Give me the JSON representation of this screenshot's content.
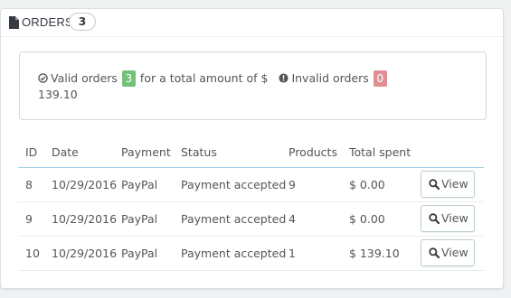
{
  "panel": {
    "title": "ORDERS",
    "count": "3",
    "icon": "file-icon"
  },
  "summary": {
    "valid_prefix": "Valid orders",
    "valid_count": "3",
    "valid_suffix": "for a total amount of $",
    "total_amount": "139.10",
    "invalid_label": "Invalid orders",
    "invalid_count": "0",
    "colors": {
      "valid_badge": "#72c279",
      "invalid_badge": "#e08f95"
    }
  },
  "table": {
    "columns": [
      "ID",
      "Date",
      "Payment",
      "Status",
      "Products",
      "Total spent"
    ],
    "rows": [
      {
        "id": "8",
        "date": "10/29/2016",
        "payment": "PayPal",
        "status": "Payment accepted",
        "products": "9",
        "total": "$ 0.00",
        "action": "View"
      },
      {
        "id": "9",
        "date": "10/29/2016",
        "payment": "PayPal",
        "status": "Payment accepted",
        "products": "4",
        "total": "$ 0.00",
        "action": "View"
      },
      {
        "id": "10",
        "date": "10/29/2016",
        "payment": "PayPal",
        "status": "Payment accepted",
        "products": "1",
        "total": "$ 139.10",
        "action": "View"
      }
    ]
  }
}
